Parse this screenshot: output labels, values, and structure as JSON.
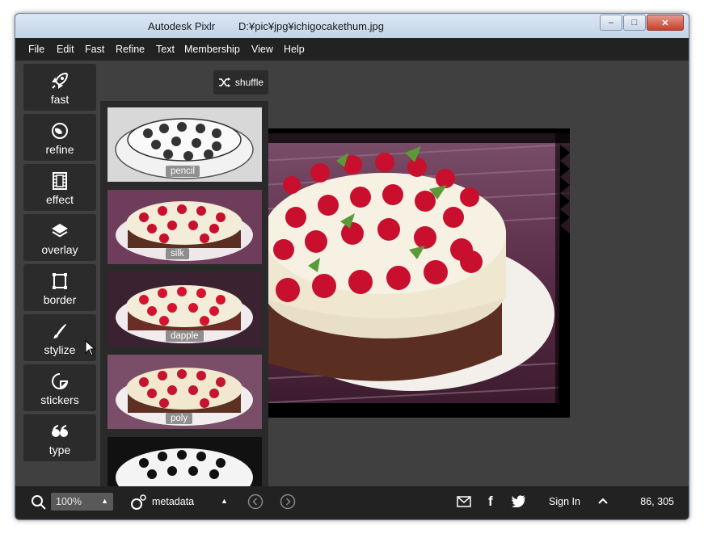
{
  "window": {
    "title": "Autodesk Pixlr        D:¥pic¥jpg¥ichigocakethum.jpg",
    "minimize_icon": "minimize-icon",
    "maximize_icon": "maximize-icon",
    "close_icon": "close-icon"
  },
  "menu": [
    "File",
    "Edit",
    "Fast",
    "Refine",
    "Text",
    "Membership",
    "View",
    "Help"
  ],
  "sidebar": [
    {
      "label": "fast",
      "icon": "rocket-icon"
    },
    {
      "label": "refine",
      "icon": "refine-icon"
    },
    {
      "label": "effect",
      "icon": "film-icon"
    },
    {
      "label": "overlay",
      "icon": "layers-icon"
    },
    {
      "label": "border",
      "icon": "border-frame-icon"
    },
    {
      "label": "stylize",
      "icon": "brush-icon"
    },
    {
      "label": "stickers",
      "icon": "sticker-icon"
    },
    {
      "label": "type",
      "icon": "quote-icon"
    }
  ],
  "shuffle": {
    "label": "shuffle",
    "icon": "shuffle-icon"
  },
  "thumbnails": [
    "pencil",
    "silk",
    "dapple",
    "poly",
    ""
  ],
  "statusbar": {
    "zoom": "100%",
    "metadata_label": "metadata",
    "sign_in": "Sign In",
    "coordinates": "86, 305"
  },
  "colors": {
    "accent_red": "#c8102e",
    "panel_dark": "#2b2b2b",
    "workspace": "#404040"
  }
}
